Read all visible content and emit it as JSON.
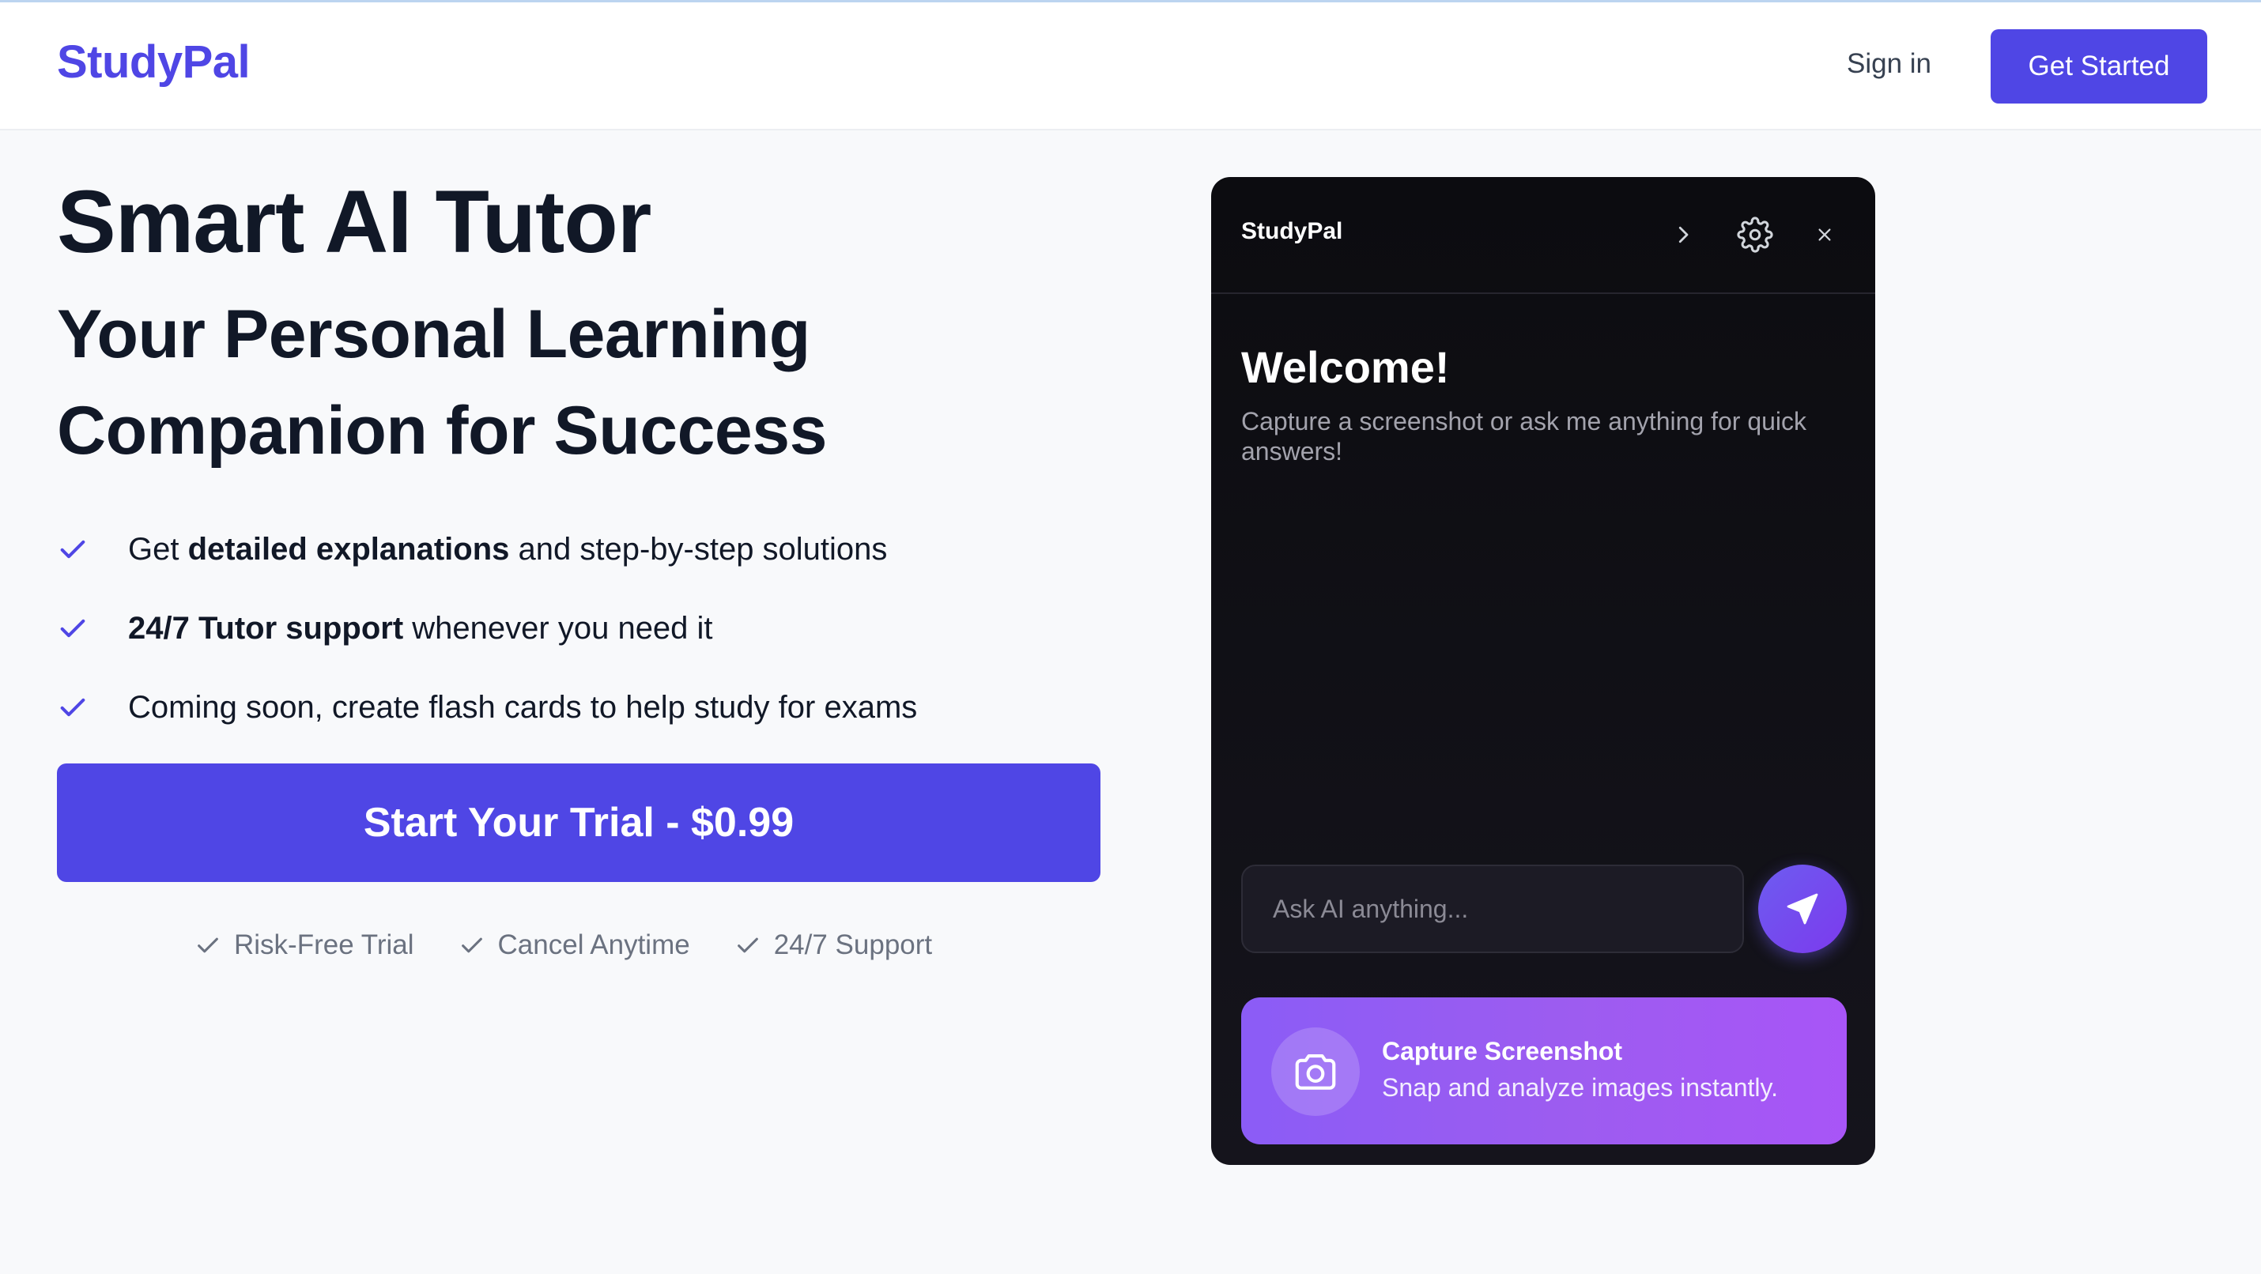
{
  "header": {
    "logo": "StudyPal",
    "sign_in": "Sign in",
    "get_started": "Get Started"
  },
  "hero": {
    "title": "Smart AI Tutor",
    "subtitle": "Your Personal Learning Companion for Success",
    "features": [
      {
        "pre": "Get ",
        "bold": "detailed explanations",
        "post": " and step-by-step solutions"
      },
      {
        "pre": "",
        "bold": "24/7 Tutor support",
        "post": " whenever you need it"
      },
      {
        "pre": "Coming soon, create flash cards to help study for exams",
        "bold": "",
        "post": ""
      }
    ],
    "cta": "Start Your Trial - $0.99",
    "assurances": [
      "Risk-Free Trial",
      "Cancel Anytime",
      "24/7 Support"
    ]
  },
  "widget": {
    "brand": "StudyPal",
    "welcome_title": "Welcome!",
    "welcome_text": "Capture a screenshot or ask me anything for quick answers!",
    "input_placeholder": "Ask AI anything...",
    "capture_title": "Capture Screenshot",
    "capture_subtitle": "Snap and analyze images instantly."
  },
  "colors": {
    "accent": "#4f46e5",
    "capture_gradient_start": "#8b5cf6",
    "panel_bg": "#0c0c10"
  }
}
